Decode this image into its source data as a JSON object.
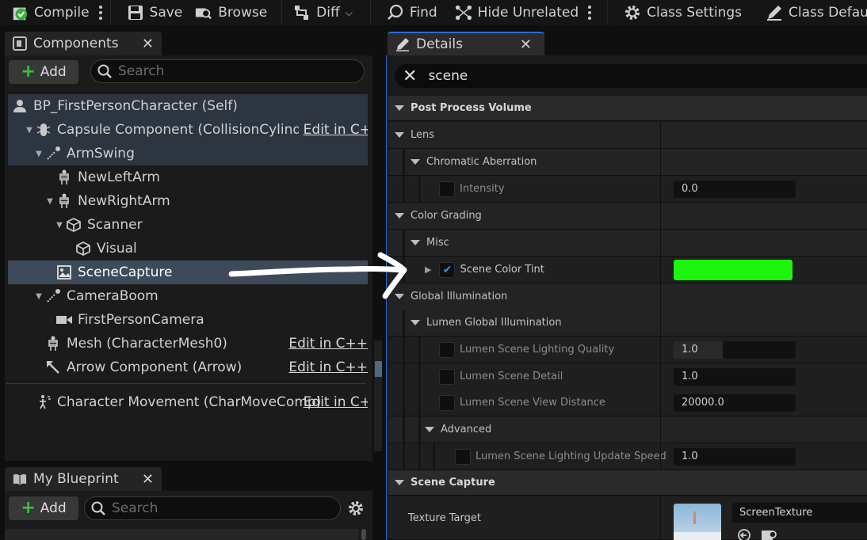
{
  "toolbar": {
    "compile": "Compile",
    "save": "Save",
    "browse": "Browse",
    "diff": "Diff",
    "find": "Find",
    "hide_unrelated": "Hide Unrelated",
    "class_settings": "Class Settings",
    "class_defaults": "Class Defaults"
  },
  "components": {
    "tab_title": "Components",
    "add_label": "Add",
    "search_placeholder": "Search",
    "edit_in_cpp": "Edit in C++",
    "edit_in_cpp_cut": "Edit in C+",
    "tree": [
      {
        "label": "BP_FirstPersonCharacter (Self)"
      },
      {
        "label": "Capsule Component (CollisionCylinder)"
      },
      {
        "label": "ArmSwing"
      },
      {
        "label": "NewLeftArm"
      },
      {
        "label": "NewRightArm"
      },
      {
        "label": "Scanner"
      },
      {
        "label": "Visual"
      },
      {
        "label": "SceneCapture"
      },
      {
        "label": "CameraBoom"
      },
      {
        "label": "FirstPersonCamera"
      },
      {
        "label": "Mesh (CharacterMesh0)"
      },
      {
        "label": "Arrow Component (Arrow)"
      },
      {
        "label": "Character Movement (CharMoveComp)"
      }
    ]
  },
  "my_blueprint": {
    "tab_title": "My Blueprint",
    "add_label": "Add",
    "search_placeholder": "Search"
  },
  "details": {
    "tab_title": "Details",
    "search_value": "scene",
    "rows": {
      "post_process_volume": "Post Process Volume",
      "lens": "Lens",
      "chromatic_aberration": "Chromatic Aberration",
      "intensity": "Intensity",
      "intensity_value": "0.0",
      "color_grading": "Color Grading",
      "misc": "Misc",
      "scene_color_tint": "Scene Color Tint",
      "global_illumination": "Global Illumination",
      "lumen_gi": "Lumen Global Illumination",
      "lumen_quality": "Lumen Scene Lighting Quality",
      "lumen_quality_value": "1.0",
      "lumen_detail": "Lumen Scene Detail",
      "lumen_detail_value": "1.0",
      "lumen_view_distance": "Lumen Scene View Distance",
      "lumen_view_distance_value": "20000.0",
      "advanced": "Advanced",
      "lumen_update_speed": "Lumen Scene Lighting Update Speed",
      "lumen_update_speed_value": "1.0",
      "scene_capture": "Scene Capture",
      "texture_target": "Texture Target",
      "texture_target_value": "ScreenTexture"
    },
    "scene_color_tint_color": "#1ef50e",
    "lumen_quality_fill": 0.4
  },
  "colors": {
    "accent": "#2a6bd1",
    "selection": "#3d4a59",
    "add_plus": "#38c43a"
  }
}
